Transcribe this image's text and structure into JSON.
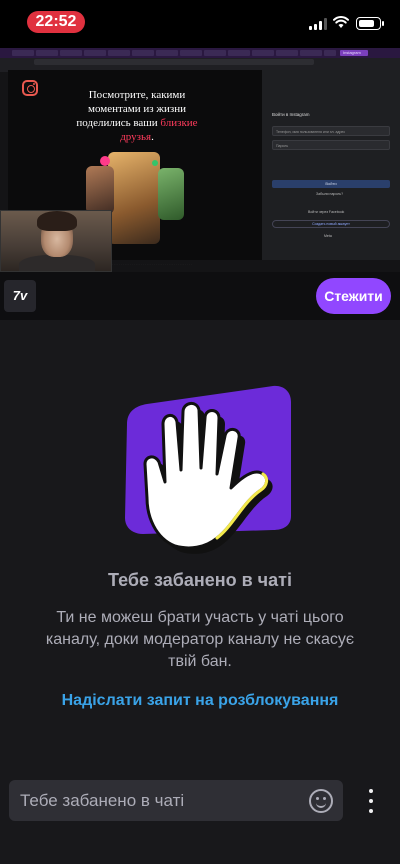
{
  "status_bar": {
    "time": "22:52",
    "battery_level": 0.8,
    "signal_bars": 3
  },
  "video": {
    "browser_active_tab": "Instagram",
    "instagram": {
      "headline_part1": "Посмотрите, какими моментами из жизни поделились ваши",
      "headline_accent": "близкие друзья",
      "headline_end": ".",
      "login_title": "Войти в Instagram",
      "username_placeholder": "Телефон, имя пользователя или эл. адрес",
      "password_placeholder": "Пароль",
      "login_button": "Войти",
      "forgot_password": "Забыли пароль?",
      "facebook_login": "Войти через Facebook",
      "create_account": "Создать новый аккаунт",
      "meta": "Meta"
    }
  },
  "channel": {
    "logo_text": "7ᴠ",
    "follow_label": "Стежити"
  },
  "banned": {
    "title": "Тебе забанено в чаті",
    "description": "Ти не можеш брати участь у чаті цього каналу, доки модератор каналу не скасує твій бан.",
    "unban_request": "Надіслати запит на розблокування"
  },
  "chat": {
    "placeholder": "Тебе забанено в чаті"
  },
  "colors": {
    "accent_purple": "#9147ff",
    "link_blue": "#3aa3e8",
    "status_red": "#e0313f"
  }
}
